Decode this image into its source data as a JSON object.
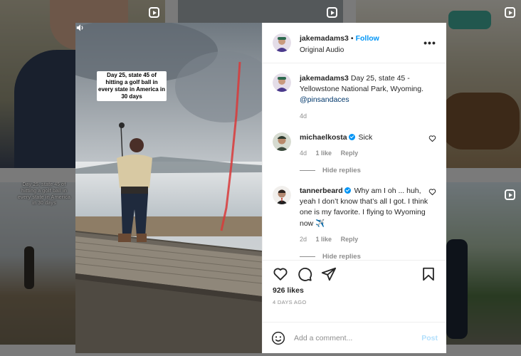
{
  "post": {
    "username": "jakemadams3",
    "follow_label": "Follow",
    "audio": "Original Audio",
    "overlay_text": "Day 25, state 45 of hitting a golf ball in every state in America in 30 days",
    "caption_text": "Day 25, state 45 - Yellowstone National Park, Wyoming.",
    "caption_mention": "@pinsandaces",
    "caption_time": "4d",
    "likes": "926 likes",
    "date": "4 DAYS AGO"
  },
  "comments": [
    {
      "username": "michaelkosta",
      "text": "Sick",
      "time": "4d",
      "likes": "1 like",
      "reply_label": "Reply",
      "hide_replies": "Hide replies"
    },
    {
      "username": "tannerbeard",
      "text": "Why am I oh ... huh, yeah I don’t know that’s all I got. I think one is my favorite. I flying to Wyoming now ✈️",
      "time": "2d",
      "likes": "1 like",
      "reply_label": "Reply",
      "hide_replies": "Hide replies"
    }
  ],
  "composer": {
    "placeholder": "Add a comment...",
    "post_label": "Post"
  },
  "background": {
    "caption_left": "Day 25, state 45 of hitting a golf ball in every state in America in 30 days"
  },
  "icons": {
    "heart": "heart-icon",
    "comment": "comment-icon",
    "share": "share-icon",
    "save": "save-icon",
    "more": "more-options-icon",
    "emoji": "emoji-icon",
    "sound": "sound-icon"
  },
  "colors": {
    "accent": "#0095f6",
    "text": "#262626",
    "muted": "#8e8e8e",
    "post_disabled": "#b2dffc"
  }
}
